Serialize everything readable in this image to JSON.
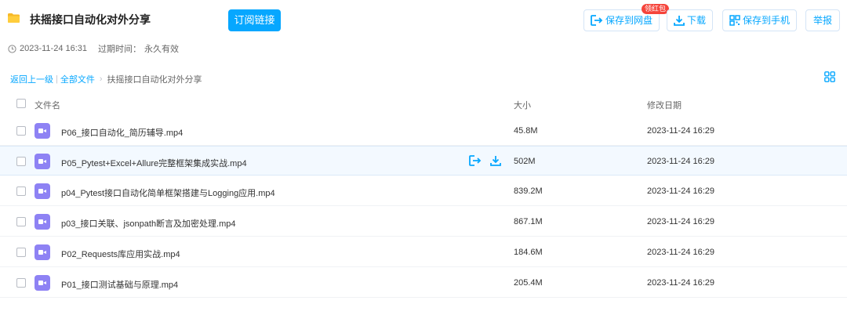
{
  "header": {
    "title": "扶摇接口自动化对外分享",
    "subscribe_label": "订阅链接",
    "badge": "领红包",
    "save_to_disk_label": "保存到网盘",
    "download_label": "下载",
    "save_to_phone_label": "保存到手机",
    "report_label": "举报",
    "accent_color": "#06a7ff"
  },
  "meta": {
    "created": "2023-11-24 16:31",
    "expire_label": "过期时间：",
    "expire_value": "永久有效"
  },
  "breadcrumb": {
    "back": "返回上一级",
    "sep": "|",
    "all_files": "全部文件",
    "arrow": "›",
    "current": "扶摇接口自动化对外分享"
  },
  "columns": {
    "name": "文件名",
    "size": "大小",
    "date": "修改日期"
  },
  "files": [
    {
      "name": "P06_接口自动化_简历辅导.mp4",
      "size": "45.8M",
      "date": "2023-11-24 16:29"
    },
    {
      "name": "P05_Pytest+Excel+Allure完整框架集成实战.mp4",
      "size": "502M",
      "date": "2023-11-24 16:29"
    },
    {
      "name": "p04_Pytest接口自动化简单框架搭建与Logging应用.mp4",
      "size": "839.2M",
      "date": "2023-11-24 16:29"
    },
    {
      "name": "p03_接口关联、jsonpath断言及加密处理.mp4",
      "size": "867.1M",
      "date": "2023-11-24 16:29"
    },
    {
      "name": "P02_Requests库应用实战.mp4",
      "size": "184.6M",
      "date": "2023-11-24 16:29"
    },
    {
      "name": "P01_接口测试基础与原理.mp4",
      "size": "205.4M",
      "date": "2023-11-24 16:29"
    }
  ]
}
